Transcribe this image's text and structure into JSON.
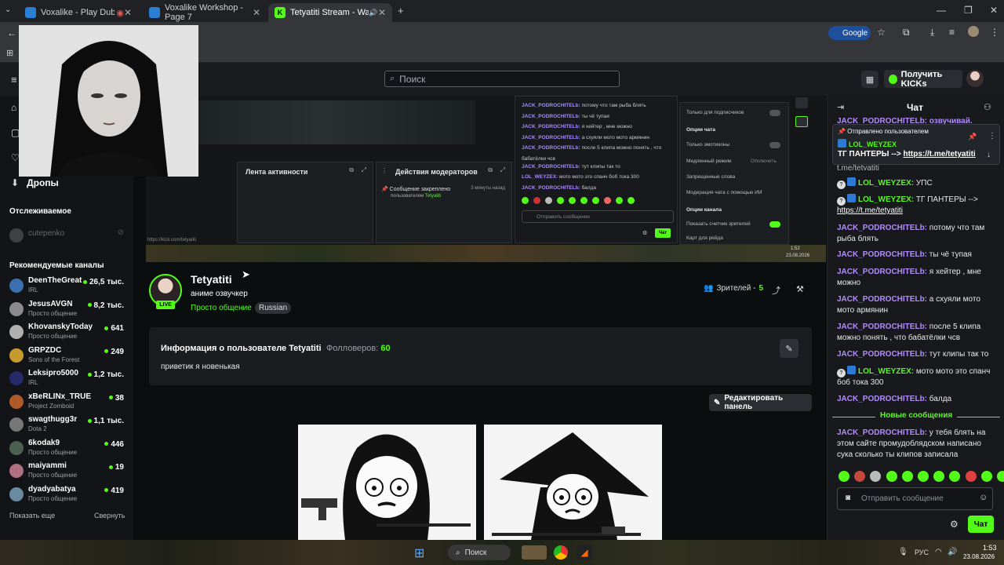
{
  "browser": {
    "tabs": [
      {
        "title": "Voxalike - Play Dub Game O"
      },
      {
        "title": "Voxalike Workshop - Page 7"
      },
      {
        "title": "Tetyatiti Stream - Watch Li"
      }
    ],
    "google_chip": "Google"
  },
  "site": {
    "search_placeholder": "Поиск",
    "kicks_button": "Получить KICKs",
    "menu": {
      "drops": "Дропы"
    }
  },
  "sidebar": {
    "following_heading": "Отслеживаемое",
    "following": [
      {
        "name": "cutepenko"
      }
    ],
    "recommended_heading": "Рекомендуемые каналы",
    "channels": [
      {
        "name": "DeenTheGreat",
        "category": "IRL",
        "viewers": "26,5 тыс."
      },
      {
        "name": "JesusAVGN",
        "category": "Просто общение",
        "viewers": "8,2 тыс."
      },
      {
        "name": "KhovanskyToday",
        "category": "Просто общение",
        "viewers": "641"
      },
      {
        "name": "GRPZDC",
        "category": "Sons of the Forest",
        "viewers": "249"
      },
      {
        "name": "Leksipro5000",
        "category": "IRL",
        "viewers": "1,2 тыс."
      },
      {
        "name": "xBeRLINx_TRUE",
        "category": "Project Zomboid",
        "viewers": "38"
      },
      {
        "name": "swagthugg3r",
        "category": "Dota 2",
        "viewers": "1,1 тыс."
      },
      {
        "name": "6kodak9",
        "category": "Просто общение",
        "viewers": "446"
      },
      {
        "name": "maiyammi",
        "category": "Просто общение",
        "viewers": "19"
      },
      {
        "name": "dyadyabatya",
        "category": "Просто общение",
        "viewers": "419"
      }
    ],
    "show_more": "Показать еще",
    "collapse": "Свернуть"
  },
  "video": {
    "activity_feed": "Лента активности",
    "moderator_actions": "Действия модераторов",
    "pinned_msg": "Сообщение закреплено",
    "pinned_by": "пользователем",
    "pinned_user": "Tetyatiti",
    "pinned_time": "3 минуты назад",
    "url_overlay": "https://kick.com/tetyatiti",
    "chat_lines": [
      {
        "user": "JACK_PODROCHITELb:",
        "text": "потому что там рыба блять"
      },
      {
        "user": "JACK_PODROCHITELb:",
        "text": "ты чё тупая"
      },
      {
        "user": "JACK_PODROCHITELb:",
        "text": "я хейтер , мне можно"
      },
      {
        "user": "JACK_PODROCHITELb:",
        "text": "а схуяли мото мото армянин"
      },
      {
        "user": "JACK_PODROCHITELb:",
        "text": "после 5 клипа можно понять , что"
      },
      {
        "user": "",
        "text": "бабатёлки чсв"
      },
      {
        "user": "JACK_PODROCHITELb:",
        "text": "тут клипы так то"
      },
      {
        "user": "LOL_WEYZEX:",
        "text": "мото мото это спанч боб тока 300"
      },
      {
        "user": "JACK_PODROCHITELb:",
        "text": "балда"
      }
    ],
    "send_placeholder": "Отправить сообщение",
    "chat_btn": "Чат",
    "settings": {
      "subs_only": "Только для подписчиков",
      "chat_options": "Опции чата",
      "emotes_only": "Только эмотиконы",
      "slow_mode": "Медленный режим",
      "slow_value": "Отключить",
      "banned_words": "Запрещенные слова",
      "ai_moderation": "Модерация чата с помощью ИИ",
      "channel_options": "Опции канала",
      "viewer_count": "Показать счетчик зрителей",
      "raid_map": "Карт для рейда"
    },
    "clock": "1:52",
    "date": "23.08.2026"
  },
  "streamer": {
    "name": "Tetyatiti",
    "live": "LIVE",
    "title": "аниме озвучкер",
    "category": "Просто общение",
    "language": "Russian",
    "viewers_label": "Зрителей -",
    "viewers": "5"
  },
  "info": {
    "title": "Информация о пользователе Tetyatiti",
    "followers_label": "Фолловеров:",
    "followers": "60",
    "bio": "приветик я новенькая",
    "edit_panel": "Редактировать панель"
  },
  "chat": {
    "header": "Чат",
    "top_fragment": "JACK_PODROCHITELb: озвучивай.",
    "pinned_header": "Отправлено пользователем",
    "pinned_user": "LOL_WEYZEX",
    "pinned_text": "ТГ ПАНТЕРЫ -->",
    "pinned_link": "https://t.me/tetyatiti",
    "pinned_cut": "t.me/tetyatiti",
    "new_messages": "Новые сообщения",
    "messages": [
      {
        "user": "LOL_WEYZEX:",
        "text": "УПС",
        "color": "green",
        "badges": true
      },
      {
        "user": "LOL_WEYZEX:",
        "text": "ТГ ПАНТЕРЫ -->",
        "link": "https://t.me/tetyatiti",
        "color": "green",
        "badges": true
      },
      {
        "user": "JACK_PODROCHITELb:",
        "text": "потому что там рыба блять",
        "color": "purple"
      },
      {
        "user": "JACK_PODROCHITELb:",
        "text": "ты чё тупая",
        "color": "purple"
      },
      {
        "user": "JACK_PODROCHITELb:",
        "text": "я хейтер , мне можно",
        "color": "purple"
      },
      {
        "user": "JACK_PODROCHITELb:",
        "text": "а схуяли мото мото армянин",
        "color": "purple"
      },
      {
        "user": "JACK_PODROCHITELb:",
        "text": "после 5 клипа можно понять , что бабатёлки чсв",
        "color": "purple"
      },
      {
        "user": "JACK_PODROCHITELb:",
        "text": "тут клипы так то",
        "color": "purple"
      },
      {
        "user": "LOL_WEYZEX:",
        "text": "мото мото это спанч боб тока 300",
        "color": "green",
        "badges": true
      },
      {
        "user": "JACK_PODROCHITELb:",
        "text": "балда",
        "color": "purple"
      },
      {
        "user": "JACK_PODROCHITELb:",
        "text": "у тебя блять на этом сайте промудоблядском написано сука сколько ты клипов записала",
        "color": "purple"
      }
    ],
    "input_placeholder": "Отправить сообщение",
    "send": "Чат"
  },
  "taskbar": {
    "search": "Поиск",
    "lang": "РУС",
    "time": "1:53",
    "date": "23.08.2026"
  },
  "colors": {
    "accent": "#53fc18",
    "username_purple": "#b28cff",
    "panel": "#1a1d20"
  }
}
